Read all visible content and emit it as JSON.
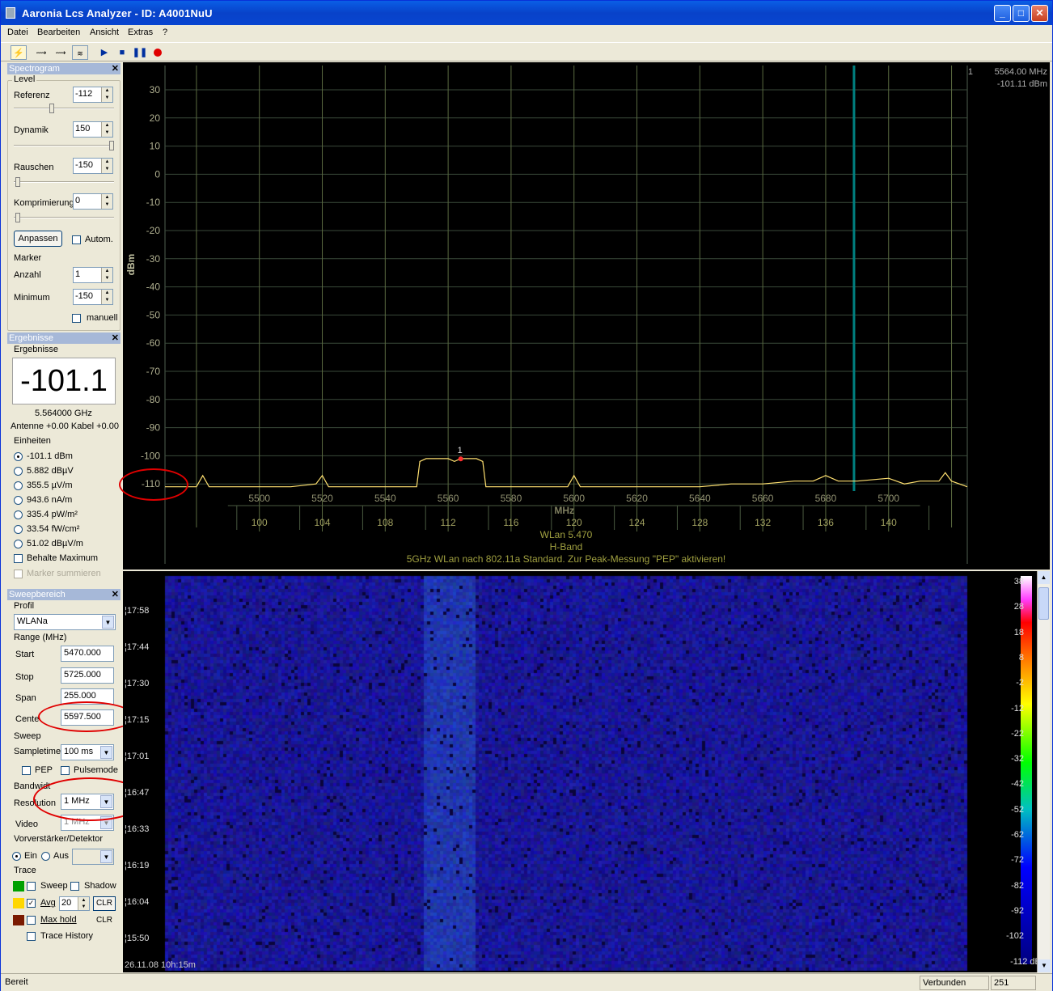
{
  "window": {
    "title": "Aaronia Lcs Analyzer - ID: A4001NuU"
  },
  "menu": [
    "Datei",
    "Bearbeiten",
    "Ansicht",
    "Extras",
    "?"
  ],
  "toolbar": {
    "icons": [
      "lightning-icon",
      "sweep-icon",
      "sweep-icon-2",
      "spectrum-icon",
      "play-icon",
      "stop-icon",
      "pause-icon",
      "record-icon"
    ]
  },
  "spectrogram_panel": {
    "title": "Spectrogram",
    "level_group": "Level",
    "referenz_label": "Referenz",
    "referenz_value": "-112",
    "dynamik_label": "Dynamik",
    "dynamik_value": "150",
    "rauschen_label": "Rauschen",
    "rauschen_value": "-150",
    "komprimierung_label": "Komprimierung",
    "komprimierung_value": "0",
    "anpassen_label": "Anpassen",
    "autom_label": "Autom.",
    "marker_group": "Marker",
    "anzahl_label": "Anzahl",
    "anzahl_value": "1",
    "minimum_label": "Minimum",
    "minimum_value": "-150",
    "manuell_label": "manuell"
  },
  "ergebnisse_panel": {
    "title": "Ergebnisse",
    "group": "Ergebnisse",
    "big_value": "-101.1",
    "freq": "5.564000 GHz",
    "antenne": "Antenne +0.00 Kabel +0.00",
    "einheiten_group": "Einheiten",
    "units": [
      "-101.1 dBm",
      "5.882 dBµV",
      "355.5 µV/m",
      "943.6 nA/m",
      "335.4 pW/m²",
      "33.54 fW/cm²",
      "51.02 dBµV/m"
    ],
    "behalte_label": "Behalte Maximum",
    "marker_summieren_label": "Marker summieren"
  },
  "sweep_panel": {
    "title": "Sweepbereich",
    "profil_group": "Profil",
    "profil_value": "WLANa",
    "range_group": "Range (MHz)",
    "start_label": "Start",
    "start_value": "5470.000",
    "stop_label": "Stop",
    "stop_value": "5725.000",
    "span_label": "Span",
    "span_value": "255.000",
    "center_label": "Cente",
    "center_value": "5597.500",
    "sweep_group": "Sweep",
    "sampletime_label": "Sampletime",
    "sampletime_value": "100 ms",
    "pep_label": "PEP",
    "pulsemode_label": "Pulsemode",
    "bandwidth_group": "Bandwidt",
    "resolution_label": "Resolution",
    "resolution_value": "1 MHz",
    "video_label": "Video",
    "video_value": "1 MHz",
    "vorv_group": "Vorverstärker/Detektor",
    "ein_label": "Ein",
    "aus_label": "Aus",
    "trace_group": "Trace",
    "sweep_label": "Sweep",
    "shadow_label": "Shadow",
    "avg_label": "Avg",
    "avg_value": "20",
    "clr_label": "CLR",
    "maxhold_label": "Max hold",
    "trace_history_label": "Trace History",
    "colors": {
      "sweep": "#00a000",
      "avg": "#ffd700",
      "maxhold": "#7a1a00"
    }
  },
  "marker_readout": {
    "index": "1",
    "freq": "5564.00 MHz",
    "level": "-101.11 dBm"
  },
  "chart_data": {
    "type": "line",
    "ylabel": "dBm",
    "xlabel": "MHz",
    "ylim": [
      -115,
      35
    ],
    "xlim": [
      5470,
      5725
    ],
    "yticks": [
      30,
      20,
      10,
      0,
      -10,
      -20,
      -30,
      -40,
      -50,
      -60,
      -70,
      -80,
      -90,
      -100,
      -110
    ],
    "xticks": [
      5500,
      5520,
      5540,
      5560,
      5580,
      5600,
      5620,
      5640,
      5660,
      5680,
      5700
    ],
    "channels": [
      {
        "f": 5500,
        "label": "100"
      },
      {
        "f": 5520,
        "label": "104"
      },
      {
        "f": 5540,
        "label": "108"
      },
      {
        "f": 5560,
        "label": "112"
      },
      {
        "f": 5580,
        "label": "116"
      },
      {
        "f": 5600,
        "label": "120"
      },
      {
        "f": 5620,
        "label": "124"
      },
      {
        "f": 5640,
        "label": "128"
      },
      {
        "f": 5660,
        "label": "132"
      },
      {
        "f": 5680,
        "label": "136"
      },
      {
        "f": 5700,
        "label": "140"
      }
    ],
    "footer": [
      "WLan 5.470",
      "H-Band",
      "5GHz WLan nach 802.11a Standard. Zur Peak-Messung \"PEP\" aktivieren!"
    ],
    "marker": {
      "label": "1",
      "freq": 5564,
      "level": -101.1
    },
    "cursor_freq": 5689,
    "series": [
      {
        "x": [
          5470,
          5480,
          5482,
          5484,
          5490,
          5500,
          5510,
          5518,
          5520,
          5522,
          5530,
          5540,
          5548,
          5550,
          5551,
          5553,
          5556,
          5560,
          5562,
          5564,
          5566,
          5569,
          5571,
          5572,
          5574,
          5580,
          5590,
          5598,
          5600,
          5602,
          5610,
          5620,
          5630,
          5640,
          5650,
          5660,
          5670,
          5676,
          5680,
          5684,
          5690,
          5700,
          5705,
          5710,
          5716,
          5718,
          5720,
          5725
        ],
        "y": [
          -111,
          -111,
          -107,
          -111,
          -111,
          -111,
          -111,
          -110,
          -107,
          -111,
          -111,
          -111,
          -111,
          -111,
          -102,
          -101,
          -101,
          -101,
          -102,
          -101,
          -101,
          -101,
          -102,
          -111,
          -111,
          -111,
          -111,
          -111,
          -107,
          -111,
          -111,
          -111,
          -111,
          -111,
          -110,
          -110,
          -109,
          -109,
          -107,
          -109,
          -109,
          -108,
          -110,
          -109,
          -109,
          -106,
          -109,
          -111
        ]
      }
    ]
  },
  "waterfall": {
    "times": [
      "17:58",
      "17:44",
      "17:30",
      "17:15",
      "17:01",
      "16:47",
      "16:33",
      "16:19",
      "16:04",
      "15:50"
    ],
    "timestamp": "26.11.08 10h:15m",
    "colorbar_labels": [
      "38",
      "28",
      "18",
      "8",
      "-2",
      "-12",
      "-22",
      "-32",
      "-42",
      "-52",
      "-62",
      "-72",
      "-82",
      "-92",
      "-102",
      "-112 dBm"
    ]
  },
  "status": {
    "left": "Bereit",
    "connection": "Verbunden",
    "count": "251"
  }
}
